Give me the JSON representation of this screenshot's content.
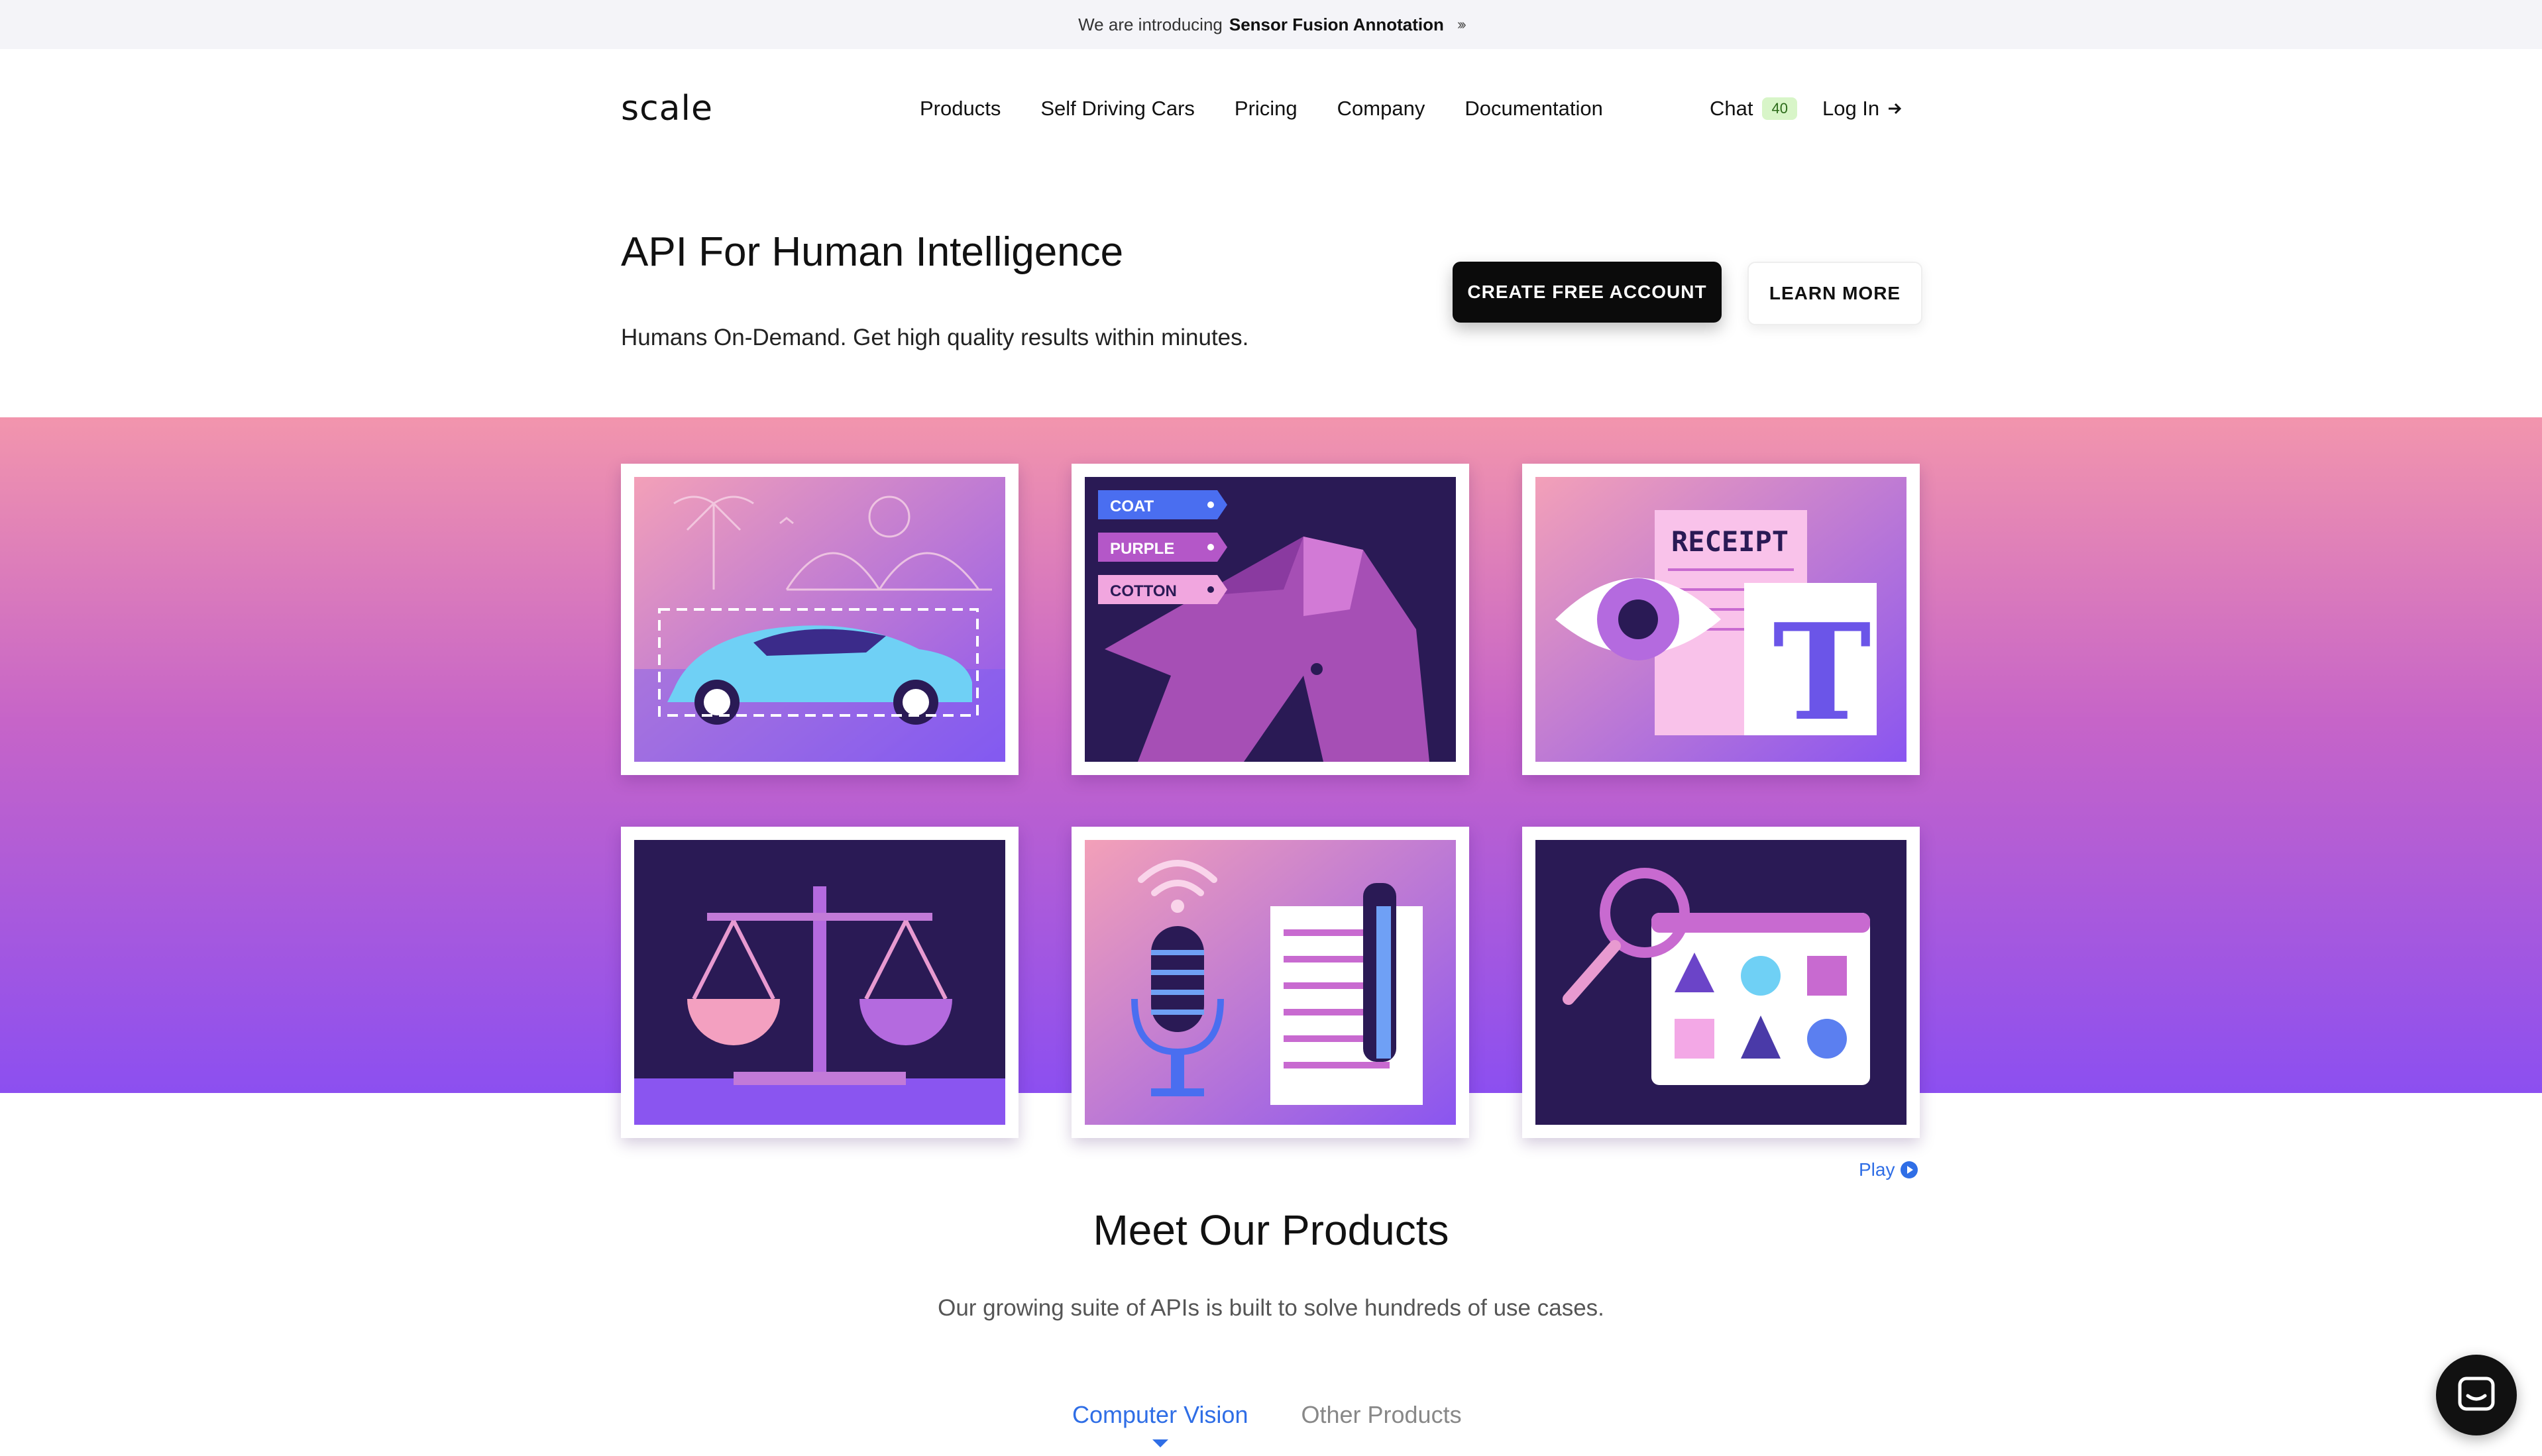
{
  "announcement": {
    "prefix": "We are introducing",
    "highlight": "Sensor Fusion Annotation",
    "arrows": "›››"
  },
  "nav": {
    "logo": "scale",
    "items": [
      "Products",
      "Self Driving Cars",
      "Pricing",
      "Company",
      "Documentation"
    ],
    "chat_label": "Chat",
    "chat_count": "40",
    "login_label": "Log In"
  },
  "hero": {
    "title": "API For Human Intelligence",
    "subtitle": "Humans On-Demand. Get high quality results within minutes.",
    "primary_cta": "CREATE FREE ACCOUNT",
    "secondary_cta": "LEARN MORE"
  },
  "illustrations": {
    "tags": [
      "COAT",
      "PURPLE",
      "COTTON"
    ],
    "receipt_label": "RECEIPT",
    "letter": "T"
  },
  "play_label": "Play",
  "products": {
    "title": "Meet Our Products",
    "subtitle": "Our growing suite of APIs is built to solve hundreds of use cases.",
    "tabs": [
      "Computer Vision",
      "Other Products"
    ]
  },
  "colors": {
    "accent": "#2f6ee6",
    "dark_bg": "#2a1a55",
    "purple": "#8c4ff0",
    "pink": "#f295ad"
  }
}
